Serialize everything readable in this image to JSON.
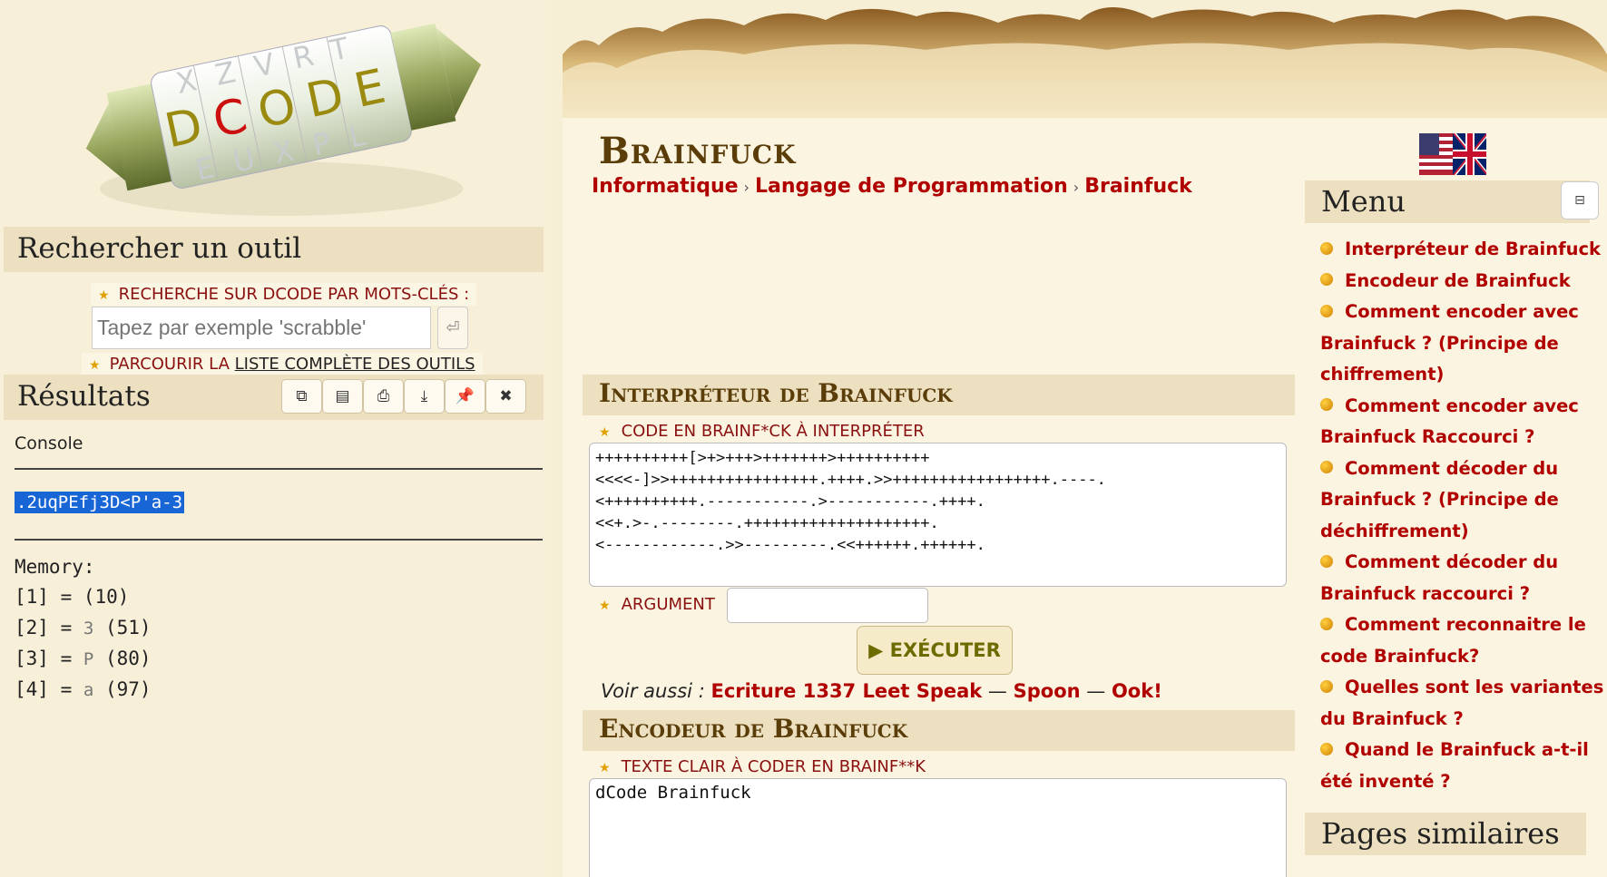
{
  "logo": {
    "brand": "DCODE",
    "alt_letters": [
      "X",
      "Z",
      "V",
      "R",
      "T",
      "E",
      "U",
      "X",
      "P",
      "L"
    ]
  },
  "search": {
    "heading": "Rechercher un outil",
    "keywords_label": "RECHERCHE SUR DCODE PAR MOTS-CLÉS :",
    "placeholder": "Tapez par exemple 'scrabble'",
    "go_icon": "⏎",
    "browse_prefix": "PARCOURIR LA",
    "browse_link": "LISTE COMPLÈTE DES OUTILS"
  },
  "results": {
    "heading": "Résultats",
    "buttons": [
      "copy-icon",
      "clipboard-icon",
      "print-icon",
      "download-icon",
      "pin-icon",
      "close-icon"
    ],
    "console_label": "Console",
    "output": ".2uqPEfj3D<P'a-3",
    "memory_label": "Memory:",
    "memory": [
      {
        "idx": "[1] =",
        "ch": "",
        "val": "(10)"
      },
      {
        "idx": "[2] =",
        "ch": "3",
        "val": "(51)"
      },
      {
        "idx": "[3] =",
        "ch": "P",
        "val": "(80)"
      },
      {
        "idx": "[4] =",
        "ch": "a",
        "val": "(97)"
      }
    ]
  },
  "page": {
    "title": "Brainfuck",
    "breadcrumb": [
      "Informatique",
      "Langage de Programmation",
      "Brainfuck"
    ],
    "breadcrumb_sep": "›"
  },
  "interpreter": {
    "heading": "Interpréteur de Brainfuck",
    "code_label": "CODE EN BRAINF*CK À INTERPRÉTER",
    "code": "++++++++++[>+>+++>+++++++>++++++++++\n<<<<-]>>++++++++++++++++.++++.>>+++++++++++++++++.----.\n<++++++++++.-----------.>-----------.++++.\n<<+.>-.--------.++++++++++++++++++++.\n<------------.>>---------.<<++++++.++++++.",
    "argument_label": "ARGUMENT",
    "argument_value": "",
    "execute_label": "▶ EXÉCUTER",
    "see_also_prefix": "Voir aussi :",
    "see_also": [
      "Ecriture 1337 Leet Speak",
      "Spoon",
      "Ook!"
    ],
    "see_also_sep": "—"
  },
  "encoder": {
    "heading": "Encodeur de Brainfuck",
    "text_label": "TEXTE CLAIR À CODER EN BRAINF**K",
    "text_value": "dCode Brainfuck"
  },
  "menu": {
    "heading": "Menu",
    "toggle_icon": "⊟",
    "items": [
      "Interpréteur de Brainfuck",
      "Encodeur de Brainfuck",
      "Comment encoder avec Brainfuck ? (Principe de chiffrement)",
      "Comment encoder avec Brainfuck Raccourci ?",
      "Comment décoder du Brainfuck ? (Principe de déchiffrement)",
      "Comment décoder du Brainfuck raccourci ?",
      "Comment reconnaitre le code Brainfuck?",
      "Quelles sont les variantes du Brainfuck ?",
      "Quand le Brainfuck a-t-il été inventé ?"
    ],
    "similar_heading": "Pages similaires"
  },
  "colors": {
    "link": "#b00000",
    "heading": "#5a3d08",
    "panel": "#ece0c0",
    "background": "#f7eed6"
  }
}
